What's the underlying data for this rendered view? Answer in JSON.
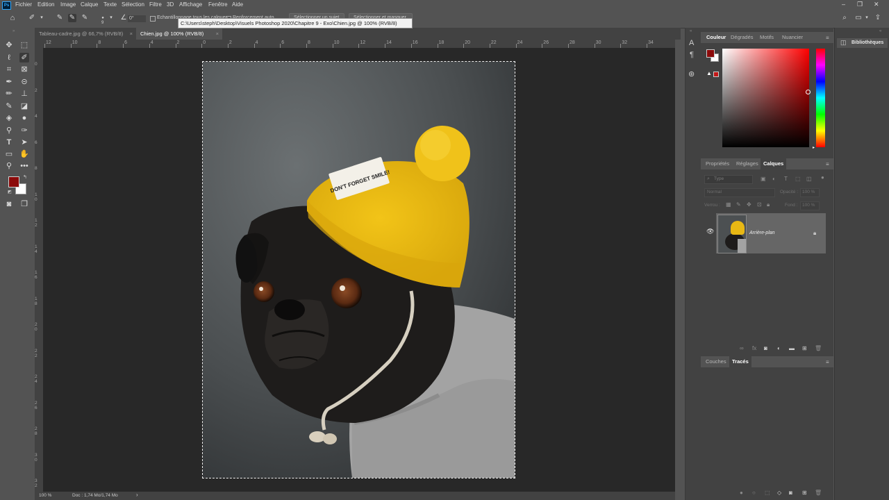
{
  "app": {
    "icon": "Ps"
  },
  "menu": [
    "Fichier",
    "Edition",
    "Image",
    "Calque",
    "Texte",
    "Sélection",
    "Filtre",
    "3D",
    "Affichage",
    "Fenêtre",
    "Aide"
  ],
  "window": {
    "minimize": "–",
    "restore": "❐",
    "close": "✕"
  },
  "options": {
    "brush_size": "9",
    "angle": "0°",
    "sample_all_layers": "Echantillonnage tous les calques",
    "enhance_edge": "Renforcement auto",
    "subtract_subject": "Sélectionner un sujet",
    "select_mask": "Sélectionner et masquer..."
  },
  "tooltip": "C:\\Users\\steph\\Desktop\\Visuels Photoshop 2020\\Chapitre 9 - Exo\\Chien.jpg @ 100% (RVB/8)",
  "tabs": [
    {
      "label": "Tableau-cadre.jpg @ 66,7% (RVB/8)",
      "close": "×"
    },
    {
      "label": "Chien.jpg @ 100% (RVB/8)",
      "close": "×"
    }
  ],
  "ruler": {
    "h": [
      "12",
      "10",
      "8",
      "6",
      "4",
      "2",
      "0",
      "2",
      "4",
      "6",
      "8",
      "10",
      "12",
      "14",
      "16",
      "18",
      "20",
      "22",
      "24",
      "26",
      "28",
      "30",
      "32",
      "34"
    ],
    "v": [
      "0",
      "2",
      "4",
      "6",
      "8",
      "1\n0",
      "1\n2",
      "1\n4",
      "1\n6",
      "1\n8",
      "2\n0",
      "2\n2",
      "2\n4",
      "2\n6",
      "2\n8",
      "3\n0",
      "3\n2"
    ]
  },
  "hat_text": "DON'T FORGET SMILE!",
  "status": {
    "zoom": "100 %",
    "doc": "Doc : 1,74 Mo/1,74 Mo",
    "arrow": "›"
  },
  "colors": {
    "foreground": "#8b0a0a",
    "background": "#ffffff",
    "accent": "#31a8ff"
  },
  "color_panel": {
    "tabs": [
      "Couleur",
      "Dégradés",
      "Motifs",
      "Nuancier"
    ],
    "menu": "≡"
  },
  "layers_panel": {
    "tabs": [
      "Propriétés",
      "Réglages",
      "Calques"
    ],
    "filter_placeholder": "Type",
    "blend_mode": "Normal",
    "opacity_label": "Opacité :",
    "opacity_value": "100 %",
    "lock_label": "Verrou :",
    "fill_label": "Fond :",
    "fill_value": "100 %",
    "layer_name": "Arrière-plan"
  },
  "paths_panel": {
    "tabs": [
      "Couches",
      "Tracés"
    ]
  },
  "libraries": {
    "label": "Bibliothèques"
  }
}
